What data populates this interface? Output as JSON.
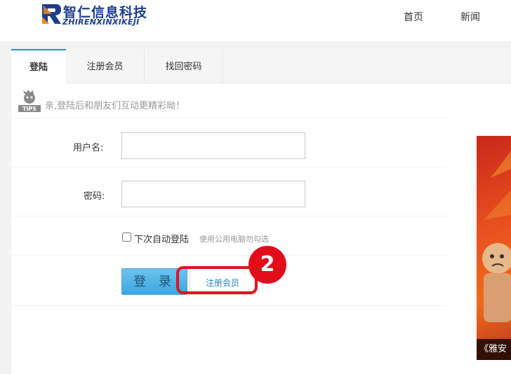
{
  "header": {
    "logo_cn": "智仁信息科技",
    "logo_en": "ZHIRENXINXIKEJI",
    "nav": {
      "home": "首页",
      "news": "新闻"
    }
  },
  "tabs": {
    "login": "登陆",
    "register": "注册会员",
    "recover": "找回密码"
  },
  "tips": {
    "badge": "TIPS",
    "text": "亲,登陆后和朋友们互动更精彩呦！"
  },
  "form": {
    "username_label": "用户名:",
    "password_label": "密码:",
    "username_value": "",
    "password_value": "",
    "auto_login_label": "下次自动登陆",
    "auto_login_hint": "使用公用电脑勿勾选",
    "login_button": "登 录",
    "register_button": "注册会员"
  },
  "annotation": {
    "step": "2",
    "color": "#e30d1a"
  },
  "banner": {
    "caption": "《雅安"
  },
  "colors": {
    "accent": "#2f8bd8",
    "logo": "#1b3e8c",
    "button": "#3aa7e1"
  }
}
